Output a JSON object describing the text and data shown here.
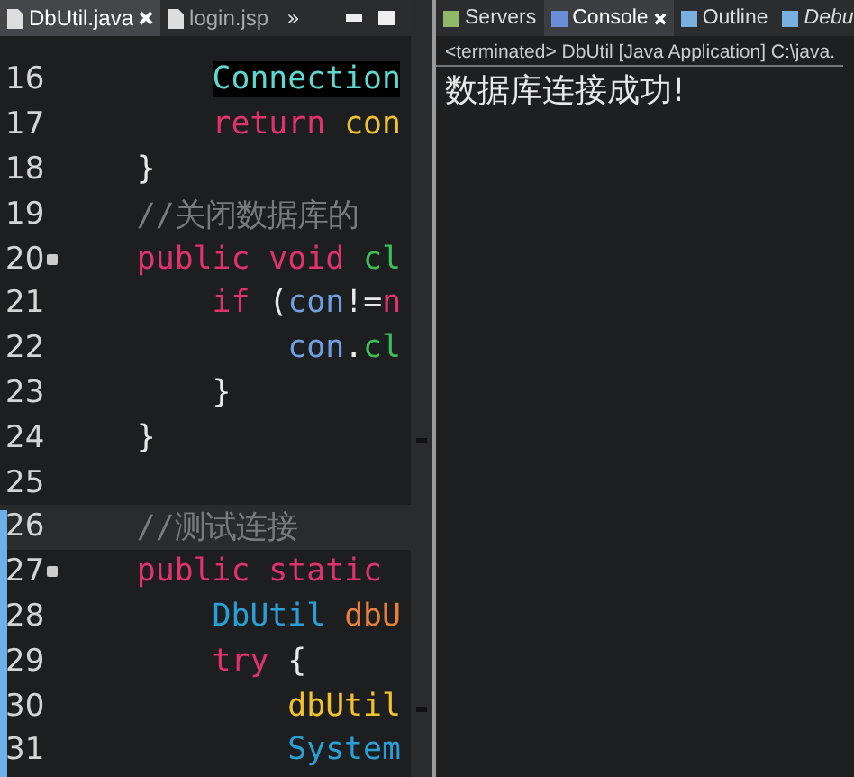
{
  "editor": {
    "tabs": [
      {
        "label": "DbUtil.java",
        "selected": true,
        "closable": true
      },
      {
        "label": "login.jsp",
        "selected": false,
        "closable": false
      }
    ],
    "overflow": "»",
    "lines": [
      {
        "number": "16",
        "fold": false,
        "current": false,
        "tokens": [
          {
            "kind": "type-hl",
            "text": "        Connection"
          }
        ]
      },
      {
        "number": "17",
        "fold": false,
        "current": false,
        "tokens": [
          {
            "kind": "keyword",
            "text": "        return"
          },
          {
            "kind": "var",
            "text": " con"
          }
        ]
      },
      {
        "number": "18",
        "fold": false,
        "current": false,
        "tokens": [
          {
            "kind": "plain",
            "text": "    }"
          }
        ]
      },
      {
        "number": "19",
        "fold": false,
        "current": false,
        "tokens": [
          {
            "kind": "comment",
            "text": "    //关闭数据库的"
          }
        ]
      },
      {
        "number": "20",
        "fold": true,
        "current": false,
        "tokens": [
          {
            "kind": "keyword",
            "text": "    public void"
          },
          {
            "kind": "method",
            "text": " cl"
          }
        ]
      },
      {
        "number": "21",
        "fold": false,
        "current": false,
        "tokens": [
          {
            "kind": "keyword",
            "text": "        if"
          },
          {
            "kind": "plain",
            "text": " ("
          },
          {
            "kind": "field",
            "text": "con"
          },
          {
            "kind": "plain",
            "text": "!="
          },
          {
            "kind": "keyword",
            "text": "n"
          }
        ]
      },
      {
        "number": "22",
        "fold": false,
        "current": false,
        "tokens": [
          {
            "kind": "field",
            "text": "            con"
          },
          {
            "kind": "plain",
            "text": "."
          },
          {
            "kind": "method",
            "text": "cl"
          }
        ]
      },
      {
        "number": "23",
        "fold": false,
        "current": false,
        "tokens": [
          {
            "kind": "plain",
            "text": "        }"
          }
        ]
      },
      {
        "number": "24",
        "fold": false,
        "current": false,
        "tokens": [
          {
            "kind": "plain",
            "text": "    }"
          }
        ]
      },
      {
        "number": "25",
        "fold": false,
        "current": false
      },
      {
        "number": "26",
        "fold": false,
        "current": true,
        "tokens": [
          {
            "kind": "comment",
            "text": "    //测试连接"
          }
        ]
      },
      {
        "number": "27",
        "fold": true,
        "current": false,
        "tokens": [
          {
            "kind": "keyword",
            "text": "    public static"
          }
        ]
      },
      {
        "number": "28",
        "fold": false,
        "current": false,
        "tokens": [
          {
            "kind": "class",
            "text": "        DbUtil"
          },
          {
            "kind": "local",
            "text": " dbU"
          }
        ]
      },
      {
        "number": "29",
        "fold": false,
        "current": false,
        "tokens": [
          {
            "kind": "keyword",
            "text": "        try"
          },
          {
            "kind": "plain",
            "text": " {"
          }
        ]
      },
      {
        "number": "30",
        "fold": false,
        "current": false,
        "tokens": [
          {
            "kind": "var",
            "text": "            dbUtil"
          }
        ]
      },
      {
        "number": "31",
        "fold": false,
        "current": false,
        "tokens": [
          {
            "kind": "class",
            "text": "            System"
          }
        ]
      }
    ]
  },
  "console": {
    "tabs": [
      {
        "label": "Servers",
        "selected": false,
        "closable": false,
        "italic": false
      },
      {
        "label": "Console",
        "selected": true,
        "closable": true,
        "italic": false
      },
      {
        "label": "Outline",
        "selected": false,
        "closable": false,
        "italic": false
      },
      {
        "label": "Debu",
        "selected": false,
        "closable": false,
        "italic": true
      }
    ],
    "header": "<terminated> DbUtil [Java Application] C:\\java.",
    "output": "数据库连接成功!"
  }
}
